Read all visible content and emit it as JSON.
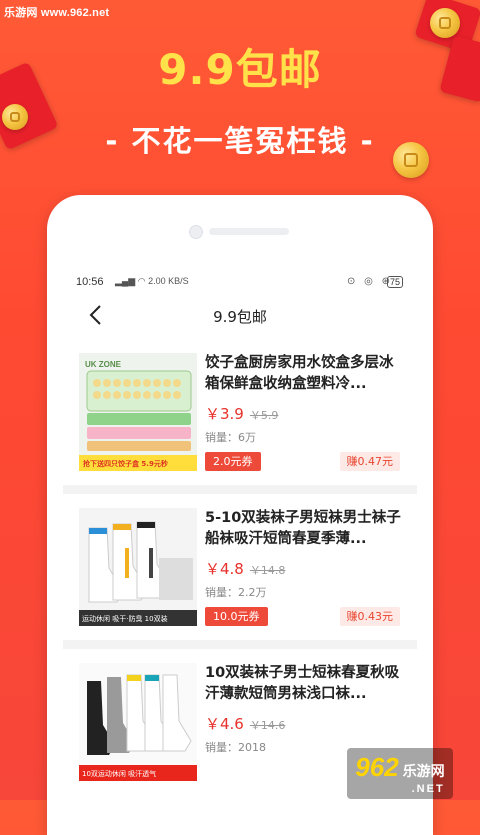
{
  "watermark_top": "乐游网 www.962.net",
  "hero": {
    "title": "9.9包邮",
    "subtitle": "- 不花一笔冤枉钱 -"
  },
  "statusbar": {
    "time": "10:56",
    "network_speed": "2.00 KB/S",
    "battery": "75"
  },
  "nav": {
    "title": "9.9包邮"
  },
  "products": [
    {
      "title": "饺子盒厨房家用水饺盒多层冰箱保鲜盒收纳盒塑料冷...",
      "price": "￥3.9",
      "original_price": "￥5.9",
      "sales": "销量：6万",
      "coupon": "2.0元券",
      "earn": "赚0.47元",
      "thumb_banner": "抢下送四只饺子盒 5.9元秒",
      "thumb_brand": "UK ZONE"
    },
    {
      "title": "5-10双装袜子男短袜男士袜子船袜吸汗短筒春夏季薄...",
      "price": "￥4.8",
      "original_price": "￥14.8",
      "sales": "销量：2.2万",
      "coupon": "10.0元券",
      "earn": "赚0.43元",
      "thumb_banner": "运动休闲  吸干·防臭  10双装"
    },
    {
      "title": "10双装袜子男士短袜春夏秋吸汗薄款短筒男袜浅口袜...",
      "price": "￥4.6",
      "original_price": "￥14.6",
      "sales": "销量：2018",
      "coupon": "",
      "earn": "",
      "thumb_banner": "10双运动休闲  吸汗透气"
    }
  ],
  "bottom_watermark": {
    "num": "962",
    "cn": "乐游网",
    "net": ".NET"
  },
  "colors": {
    "background": "#ff4a32",
    "hero_title": "#ffe14a",
    "price": "#e8312b",
    "coupon_bg": "#ee4a3a",
    "earn_bg": "#fde9e6"
  },
  "icons": [
    "back-arrow-icon",
    "wifi-icon",
    "signal-icon",
    "battery-icon",
    "coin-icon",
    "red-envelope-icon"
  ]
}
